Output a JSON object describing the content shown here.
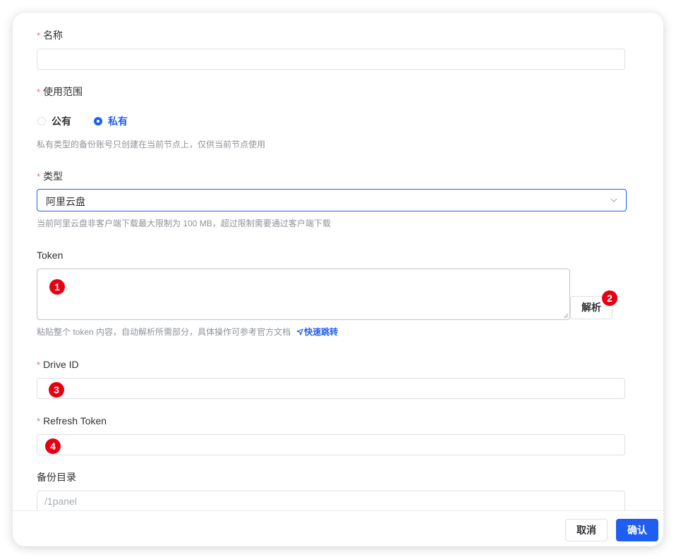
{
  "form": {
    "name": {
      "label": "名称",
      "value": ""
    },
    "scope": {
      "label": "使用范围",
      "options": [
        "公有",
        "私有"
      ],
      "selected": "私有",
      "hint": "私有类型的备份账号只创建在当前节点上，仅供当前节点使用"
    },
    "type": {
      "label": "类型",
      "value": "阿里云盘",
      "hint": "当前阿里云盘非客户端下载最大限制为 100 MB，超过限制需要通过客户端下载"
    },
    "token": {
      "label": "Token",
      "value": "",
      "parse_button": "解析",
      "hint": "粘贴整个 token 内容，自动解析所需部分，具体操作可参考官方文档",
      "link_text": "快速跳转"
    },
    "drive_id": {
      "label": "Drive ID",
      "value": ""
    },
    "refresh_token": {
      "label": "Refresh Token",
      "value": ""
    },
    "backup_dir": {
      "label": "备份目录",
      "placeholder": "/1panel"
    }
  },
  "annotations": [
    "1",
    "2",
    "3",
    "4"
  ],
  "footer": {
    "cancel": "取消",
    "confirm": "确认"
  },
  "colors": {
    "primary": "#1f5ef0",
    "required": "#f56c6c",
    "badge": "#e60012"
  }
}
